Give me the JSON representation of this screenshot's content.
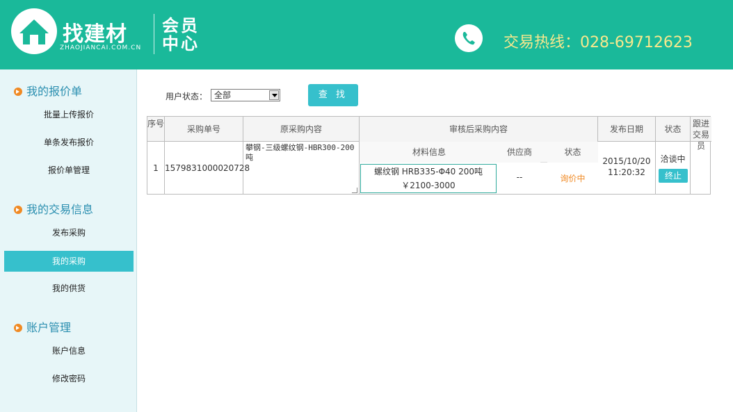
{
  "header": {
    "logo_cn": "找建材",
    "logo_en": "ZHAOJIANCAI.COM.CN",
    "member_center": "会员中心",
    "hotline": "交易热线：028-69712623"
  },
  "sidebar": {
    "sections": [
      {
        "title": "我的报价单",
        "items": [
          "批量上传报价",
          "单条发布报价",
          "报价单管理"
        ]
      },
      {
        "title": "我的交易信息",
        "items": [
          "发布采购",
          "我的采购",
          "我的供货"
        ]
      },
      {
        "title": "账户管理",
        "items": [
          "账户信息",
          "修改密码"
        ]
      }
    ],
    "active_item": "我的采购"
  },
  "filter": {
    "label": "用户状态：",
    "selected": "全部",
    "search_button": "查 找"
  },
  "table": {
    "headers": {
      "seq": "序号",
      "order_no": "采购单号",
      "original": "原采购内容",
      "reviewed": "审核后采购内容",
      "publish_date": "发布日期",
      "status": "状态",
      "follow": "跟进交易员"
    },
    "sub_headers": {
      "material": "材料信息",
      "supplier": "供应商",
      "status": "状态"
    },
    "rows": [
      {
        "seq": "1",
        "order_no": "1579831000020728",
        "original": "攀钢-三级螺纹钢-HBR300-200吨",
        "material_line1": "螺纹钢 HRB335-Φ40 200吨",
        "material_line2": "￥2100-3000",
        "supplier": "--",
        "sub_status": "询价中",
        "date": "2015/10/20",
        "time": "11:20:32",
        "status": "洽谈中",
        "action": "终止",
        "follow": ""
      }
    ]
  },
  "colors": {
    "header_bg": "#1ab99a",
    "accent": "#36c0cc",
    "hotline": "#f7e88d",
    "sidebar_bg": "#e7f6f8",
    "status_orange": "#f08a24"
  }
}
